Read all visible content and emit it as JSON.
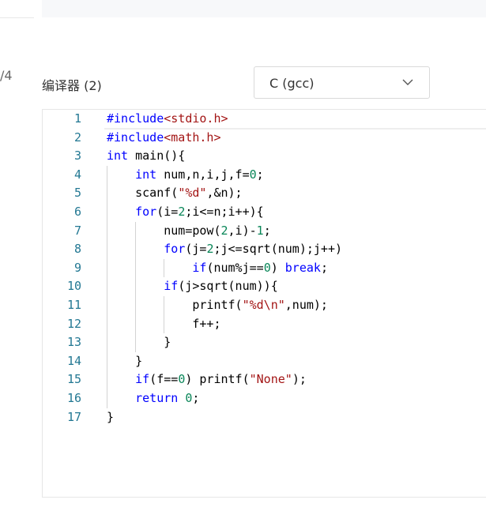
{
  "sidebar": {
    "page_counter": "/4"
  },
  "compiler": {
    "label": "编译器 (2)",
    "selected": "C (gcc)"
  },
  "editor": {
    "line_numbers": [
      "1",
      "2",
      "3",
      "4",
      "5",
      "6",
      "7",
      "8",
      "9",
      "10",
      "11",
      "12",
      "13",
      "14",
      "15",
      "16",
      "17"
    ],
    "lines": [
      [
        {
          "t": "kw",
          "v": "#include"
        },
        {
          "t": "str",
          "v": "<stdio.h>"
        }
      ],
      [
        {
          "t": "kw",
          "v": "#include"
        },
        {
          "t": "str",
          "v": "<math.h>"
        }
      ],
      [
        {
          "t": "kw",
          "v": "int"
        },
        {
          "t": "plain",
          "v": " main(){"
        }
      ],
      [
        {
          "t": "plain",
          "v": "    "
        },
        {
          "t": "kw",
          "v": "int"
        },
        {
          "t": "plain",
          "v": " num,n,i,j,f="
        },
        {
          "t": "num",
          "v": "0"
        },
        {
          "t": "plain",
          "v": ";"
        }
      ],
      [
        {
          "t": "plain",
          "v": "    scanf("
        },
        {
          "t": "str",
          "v": "\"%d\""
        },
        {
          "t": "plain",
          "v": ",&n);"
        }
      ],
      [
        {
          "t": "plain",
          "v": "    "
        },
        {
          "t": "kw",
          "v": "for"
        },
        {
          "t": "plain",
          "v": "(i="
        },
        {
          "t": "num",
          "v": "2"
        },
        {
          "t": "plain",
          "v": ";i<=n;i++){"
        }
      ],
      [
        {
          "t": "plain",
          "v": "        num=pow("
        },
        {
          "t": "num",
          "v": "2"
        },
        {
          "t": "plain",
          "v": ",i)-"
        },
        {
          "t": "num",
          "v": "1"
        },
        {
          "t": "plain",
          "v": ";"
        }
      ],
      [
        {
          "t": "plain",
          "v": "        "
        },
        {
          "t": "kw",
          "v": "for"
        },
        {
          "t": "plain",
          "v": "(j="
        },
        {
          "t": "num",
          "v": "2"
        },
        {
          "t": "plain",
          "v": ";j<=sqrt(num);j++)"
        }
      ],
      [
        {
          "t": "plain",
          "v": "            "
        },
        {
          "t": "kw",
          "v": "if"
        },
        {
          "t": "plain",
          "v": "(num%j=="
        },
        {
          "t": "num",
          "v": "0"
        },
        {
          "t": "plain",
          "v": ") "
        },
        {
          "t": "kw",
          "v": "break"
        },
        {
          "t": "plain",
          "v": ";"
        }
      ],
      [
        {
          "t": "plain",
          "v": "        "
        },
        {
          "t": "kw",
          "v": "if"
        },
        {
          "t": "plain",
          "v": "(j>sqrt(num)){"
        }
      ],
      [
        {
          "t": "plain",
          "v": "            printf("
        },
        {
          "t": "str",
          "v": "\"%d\\n\""
        },
        {
          "t": "plain",
          "v": ",num);"
        }
      ],
      [
        {
          "t": "plain",
          "v": "            f++;"
        }
      ],
      [
        {
          "t": "plain",
          "v": "        }"
        }
      ],
      [
        {
          "t": "plain",
          "v": "    }"
        }
      ],
      [
        {
          "t": "plain",
          "v": "    "
        },
        {
          "t": "kw",
          "v": "if"
        },
        {
          "t": "plain",
          "v": "(f=="
        },
        {
          "t": "num",
          "v": "0"
        },
        {
          "t": "plain",
          "v": ") printf("
        },
        {
          "t": "str",
          "v": "\"None\""
        },
        {
          "t": "plain",
          "v": ");"
        }
      ],
      [
        {
          "t": "plain",
          "v": "    "
        },
        {
          "t": "kw",
          "v": "return"
        },
        {
          "t": "plain",
          "v": " "
        },
        {
          "t": "num",
          "v": "0"
        },
        {
          "t": "plain",
          "v": ";"
        }
      ],
      [
        {
          "t": "plain",
          "v": "}"
        }
      ]
    ],
    "colors": {
      "keyword": "#0000ff",
      "string": "#a31515",
      "number": "#098658",
      "line_number": "#237893"
    },
    "icons": {
      "select_chevron": "chevron-down-icon"
    }
  }
}
